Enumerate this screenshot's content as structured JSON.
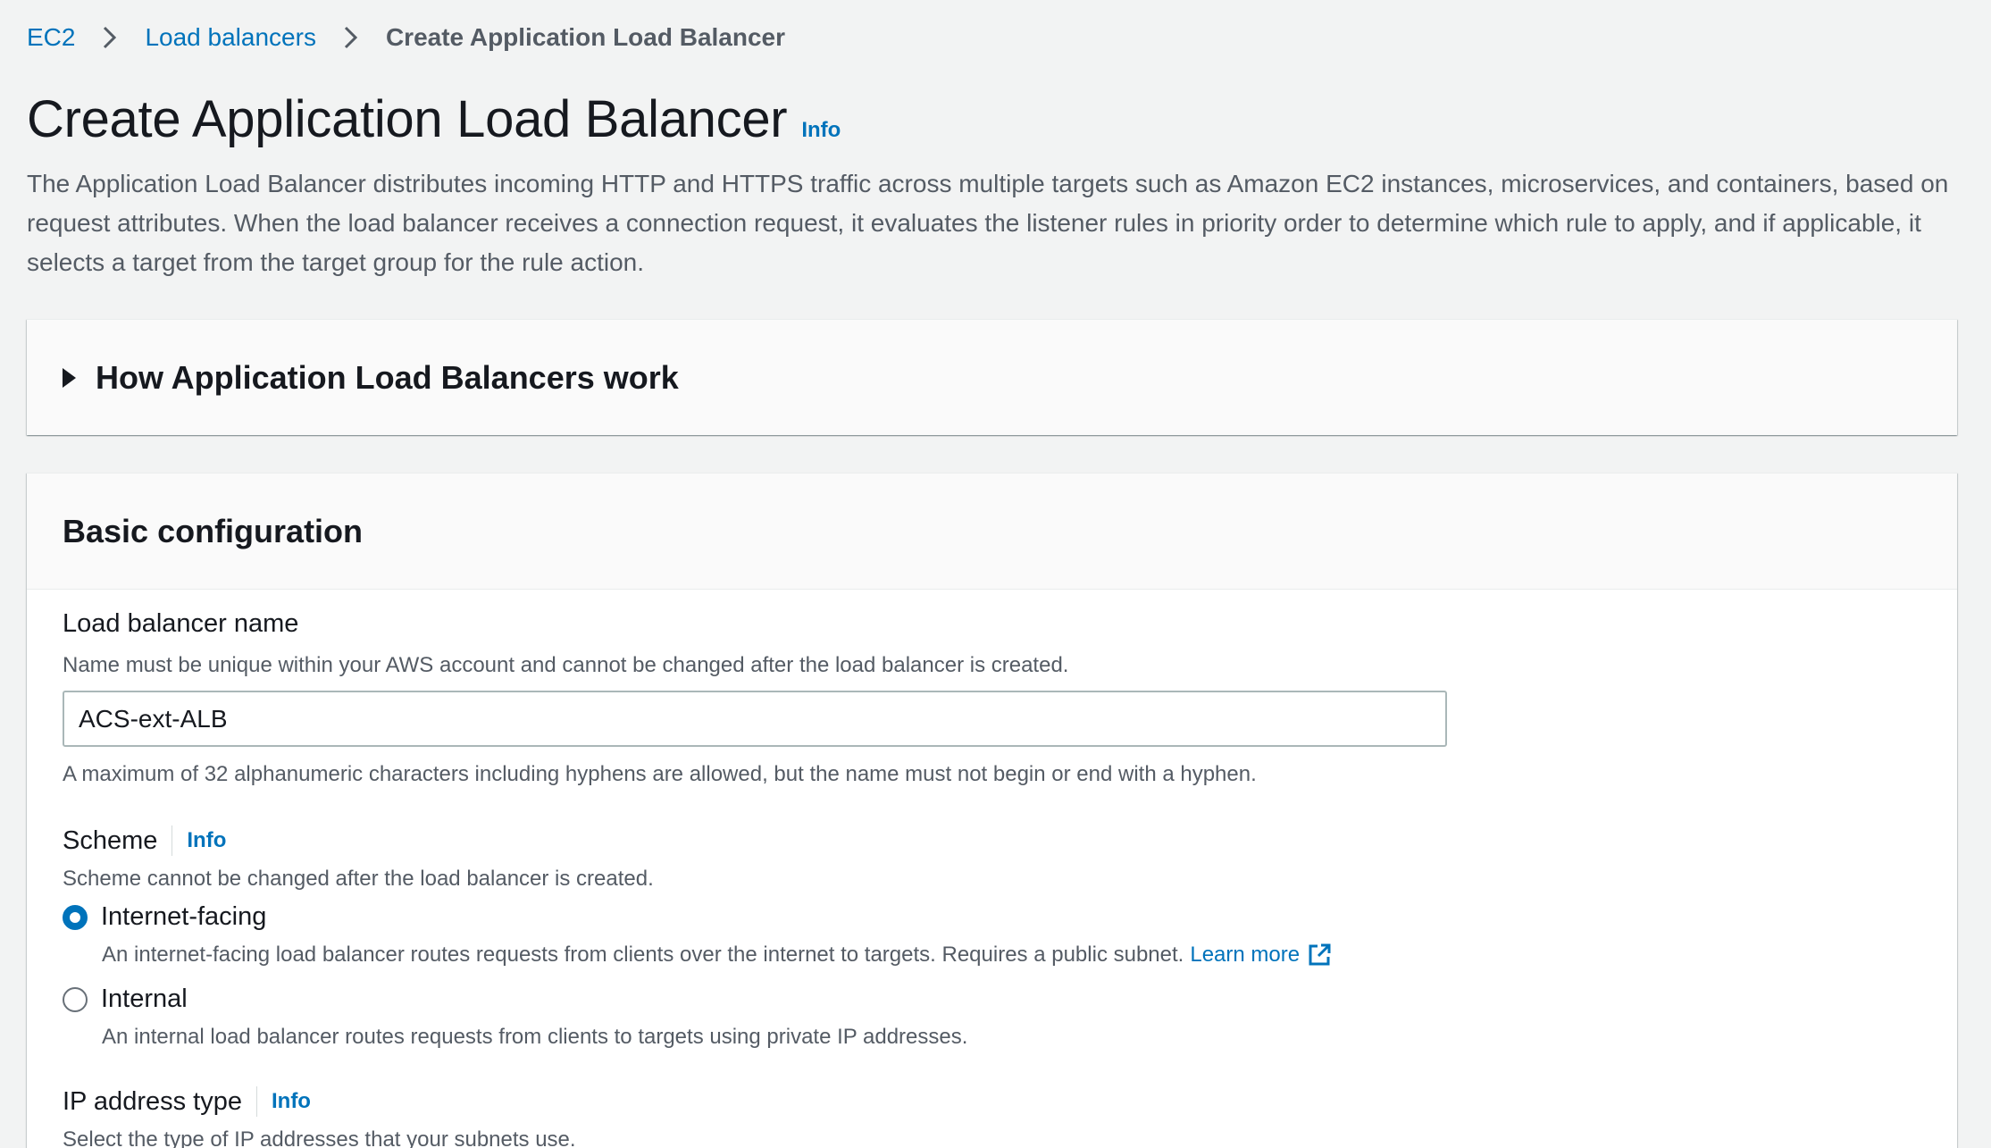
{
  "breadcrumb": {
    "items": [
      "EC2",
      "Load balancers"
    ],
    "current": "Create Application Load Balancer"
  },
  "header": {
    "title": "Create Application Load Balancer",
    "info": "Info",
    "description": "The Application Load Balancer distributes incoming HTTP and HTTPS traffic across multiple targets such as Amazon EC2 instances, microservices, and containers, based on request attributes. When the load balancer receives a connection request, it evaluates the listener rules in priority order to determine which rule to apply, and if applicable, it selects a target from the target group for the rule action."
  },
  "how_it_works": {
    "title": "How Application Load Balancers work"
  },
  "basic_config": {
    "title": "Basic configuration",
    "name_field": {
      "label": "Load balancer name",
      "description": "Name must be unique within your AWS account and cannot be changed after the load balancer is created.",
      "value": "ACS-ext-ALB",
      "constraint": "A maximum of 32 alphanumeric characters including hyphens are allowed, but the name must not begin or end with a hyphen."
    },
    "scheme": {
      "label": "Scheme",
      "info": "Info",
      "description": "Scheme cannot be changed after the load balancer is created.",
      "options": [
        {
          "label": "Internet-facing",
          "description": "An internet-facing load balancer routes requests from clients over the internet to targets. Requires a public subnet.",
          "learn_more": "Learn more",
          "selected": true
        },
        {
          "label": "Internal",
          "description": "An internal load balancer routes requests from clients to targets using private IP addresses.",
          "selected": false
        }
      ]
    },
    "ip_address_type": {
      "label": "IP address type",
      "info": "Info",
      "description": "Select the type of IP addresses that your subnets use."
    }
  },
  "icons": {
    "breadcrumb_separator": "chevron-right-icon",
    "expander": "caret-right-icon",
    "external_link": "external-link-icon"
  },
  "colors": {
    "link": "#0073bb",
    "text": "#16191f",
    "secondary_text": "#545b64",
    "background": "#f2f3f3"
  }
}
